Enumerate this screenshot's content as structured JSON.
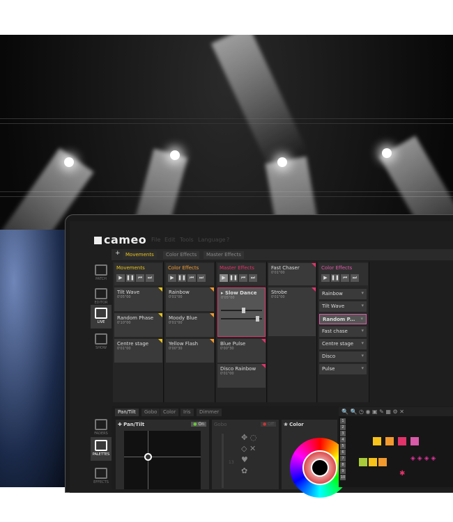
{
  "app": {
    "logo": "cameo",
    "menu": [
      "File",
      "Edit",
      "Tools",
      "Language",
      "?"
    ]
  },
  "tabs": [
    {
      "label": "Movements",
      "active": true
    },
    {
      "label": "Color Effects"
    },
    {
      "label": "Master Effects"
    }
  ],
  "add_tab": "+",
  "sidebar": {
    "top": [
      "PATCH",
      "EDITOR",
      "LIVE",
      "SHOW"
    ],
    "active": "LIVE",
    "bottom": [
      "FADERS",
      "PALETTES",
      "EFFECTS"
    ],
    "bottom_active": "PALETTES"
  },
  "columns": [
    {
      "title": "Movements",
      "color": "#e8c21a",
      "cues": [
        {
          "name": "Tilt Wave",
          "time": "0'05\"00"
        },
        {
          "name": "Random Phase",
          "time": "0'10\"00"
        },
        {
          "name": "Centre stage",
          "time": "0'01\"00"
        }
      ]
    },
    {
      "title": "Color Effects",
      "color": "#f29a2e",
      "cues": [
        {
          "name": "Rainbow",
          "time": "0'01\"00"
        },
        {
          "name": "Moody Blue",
          "time": "0'01\"00"
        },
        {
          "name": "Yellow Flash",
          "time": "0'00\"30"
        }
      ]
    },
    {
      "title": "Master Effects",
      "color": "#e2336b",
      "cues": [
        {
          "name": "Slow Dance",
          "time": "0'05\"00",
          "selected": true
        },
        {
          "name": "Blue Pulse",
          "time": "0'00\"30"
        },
        {
          "name": "Disco Rainbow",
          "time": "0'01\"00"
        }
      ]
    },
    {
      "title": "Fast Chaser",
      "time": "0'01\"00",
      "cues": [
        {
          "name": "Strobe",
          "time": "0'01\"00"
        }
      ]
    },
    {
      "title": "Color Effects",
      "color": "#e05aa8",
      "dropdown": [
        "Rainbow",
        "Tilt Wave",
        "Random P...",
        "Fast chase",
        "Centre stage",
        "Disco",
        "Pulse"
      ],
      "selected": "Random P..."
    }
  ],
  "bottom": {
    "tabs": [
      "Pan/Tilt",
      "Gobo",
      "Color",
      "Iris",
      "Dimmer"
    ],
    "active_tab": "Pan/Tilt",
    "pantilt": {
      "title": "Pan/Tilt",
      "state": "On"
    },
    "gobo": {
      "title": "Gobo",
      "state": "Off",
      "value": "13"
    },
    "color": {
      "title": "Color"
    },
    "grid_rows": [
      "1",
      "2",
      "3",
      "4",
      "5",
      "6",
      "7",
      "8",
      "9",
      "10"
    ],
    "swatches": [
      "#f7c21a",
      "#f29a2e",
      "#e2336b",
      "#d85aa8",
      "#a8cc3a",
      "#f7c21a",
      "#f29a2e"
    ]
  }
}
